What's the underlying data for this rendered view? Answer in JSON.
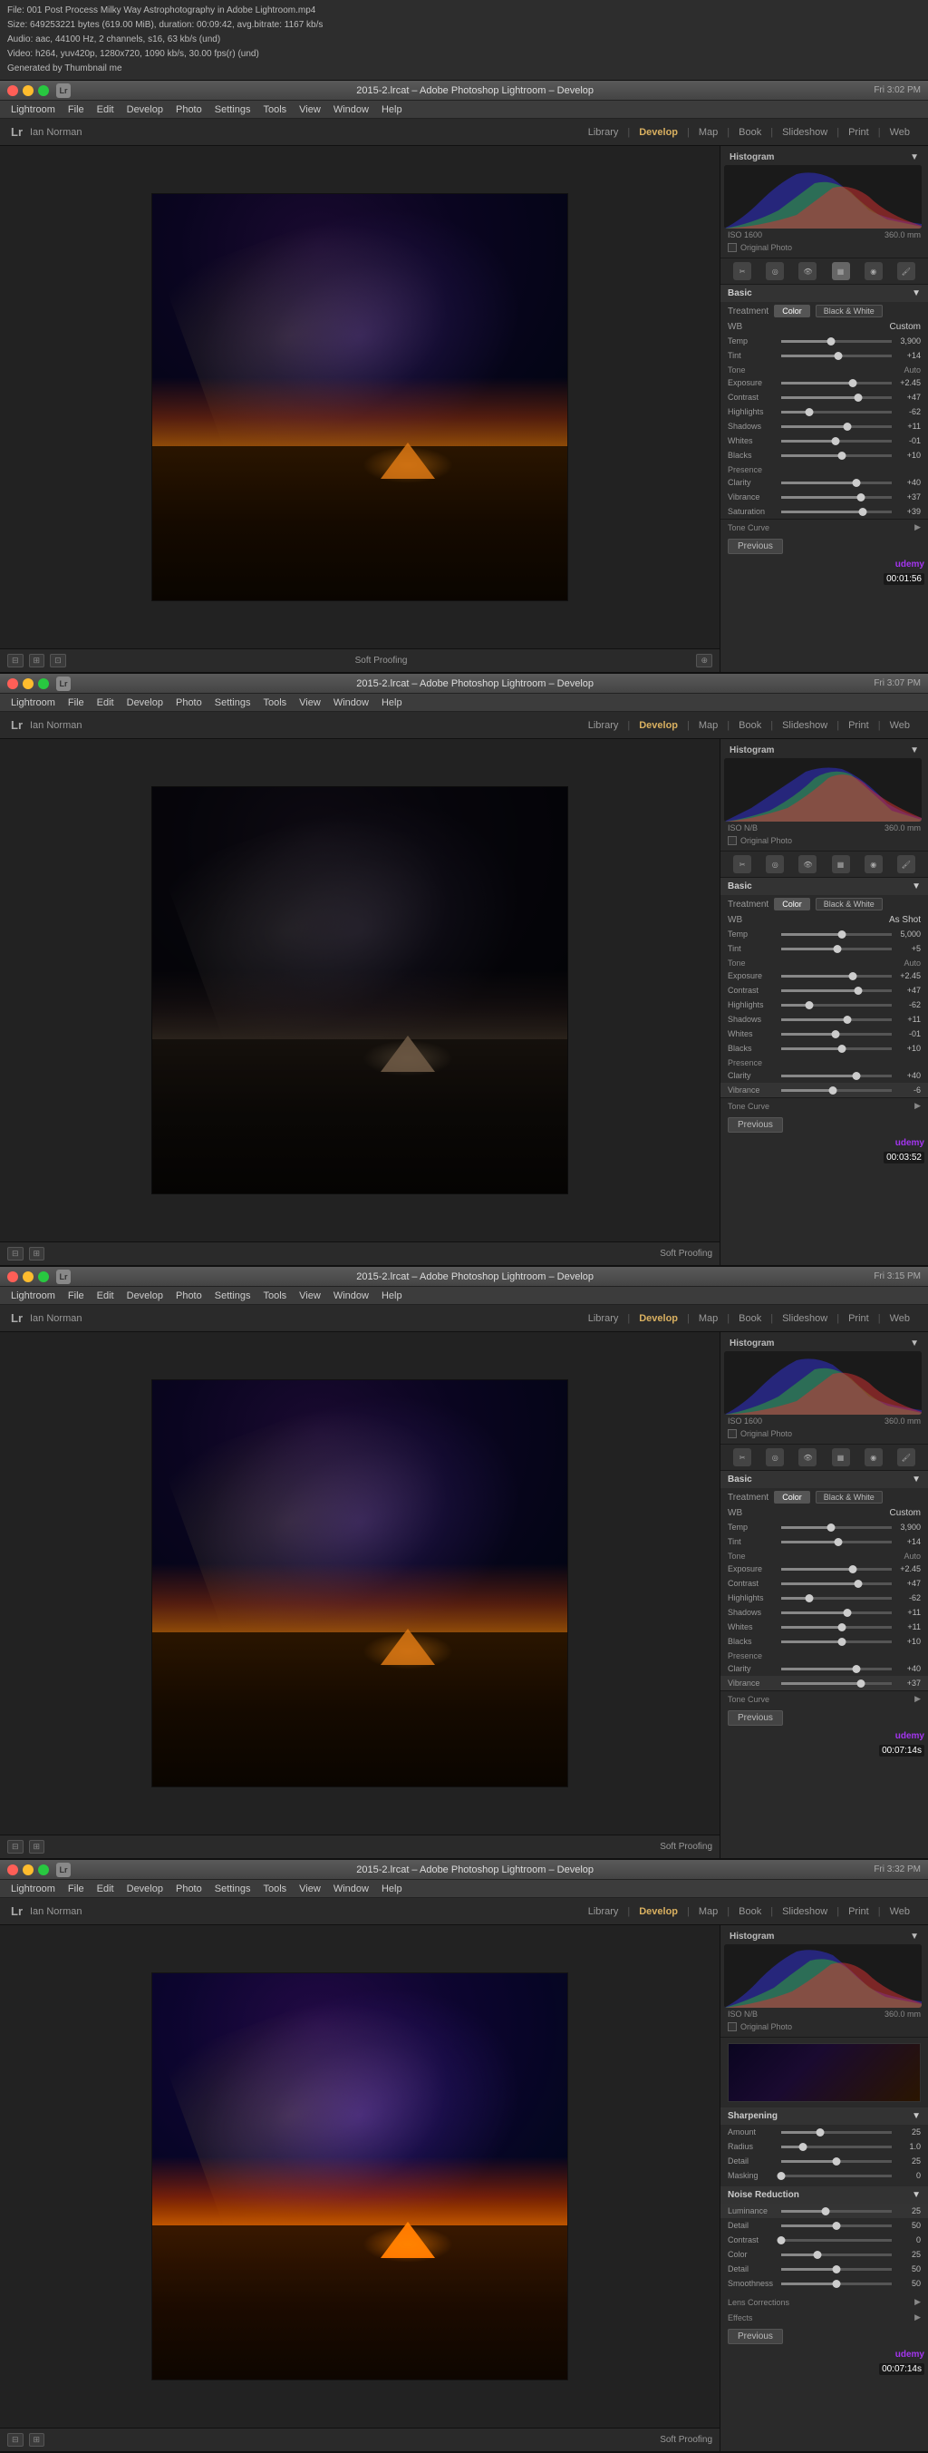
{
  "file_info": {
    "line1": "File: 001 Post Process Milky Way Astrophotography in Adobe Lightroom.mp4",
    "line2": "Size: 649253221 bytes (619.00 MiB), duration: 00:09:42, avg.bitrate: 1167 kb/s",
    "line3": "Audio: aac, 44100 Hz, 2 channels, s16, 63 kb/s (und)",
    "line4": "Video: h264, yuv420p, 1280x720, 1090 kb/s, 30.00 fps(r) (und)",
    "line5": "Generated by Thumbnail me"
  },
  "frames": [
    {
      "id": "frame1",
      "title_bar": "2015-2.lrcat – Adobe Photoshop Lightroom – Develop",
      "time_display": "Fri 3:02 PM",
      "user": "Ian Norman",
      "nav_active": "Develop",
      "nav_items": [
        "Library",
        "Develop",
        "Map",
        "Book",
        "Slideshow",
        "Print",
        "Web"
      ],
      "right_panel": {
        "iso": "ISO 1600",
        "exposure_info": "360.0 mm",
        "wb": "Custom",
        "wb_label": "WB",
        "temp": "3,900",
        "tint": "+14",
        "tone_label": "Tone",
        "tone_auto": "Auto",
        "exposure": "+2.45",
        "contrast": "+47",
        "highlights": "-62",
        "shadows": "+11",
        "whites": "-01",
        "blacks": "+10",
        "presence_label": "Presence",
        "clarity": "+40",
        "vibrance": "+37",
        "saturation": "+39"
      },
      "timestamp": "00:01:56",
      "soft_proofing": "Soft Proofing"
    },
    {
      "id": "frame2",
      "title_bar": "2015-2.lrcat – Adobe Photoshop Lightroom – Develop",
      "time_display": "Fri 3:07 PM",
      "user": "Ian Norman",
      "nav_active": "Develop",
      "nav_items": [
        "Library",
        "Develop",
        "Map",
        "Book",
        "Slideshow",
        "Print",
        "Web"
      ],
      "right_panel": {
        "iso": "ISO N/B",
        "exposure_info": "360.0 mm",
        "wb": "As Shot",
        "wb_label": "WB",
        "temp": "5,000",
        "tint": "+5",
        "tone_label": "Tone",
        "tone_auto": "Auto",
        "exposure": "+2.45",
        "contrast": "+47",
        "highlights": "-62",
        "shadows": "+11",
        "whites": "-01",
        "blacks": "+10",
        "presence_label": "Presence",
        "clarity": "+40",
        "vibrance": "-6",
        "saturation": ""
      },
      "timestamp": "00:03:52",
      "soft_proofing": "Soft Proofing"
    },
    {
      "id": "frame3",
      "title_bar": "2015-2.lrcat – Adobe Photoshop Lightroom – Develop",
      "time_display": "Fri 3:15 PM",
      "user": "Ian Norman",
      "nav_active": "Develop",
      "nav_items": [
        "Library",
        "Develop",
        "Map",
        "Book",
        "Slideshow",
        "Print",
        "Web"
      ],
      "right_panel": {
        "iso": "ISO 1600",
        "exposure_info": "360.0 mm",
        "wb": "Custom",
        "wb_label": "WB",
        "temp": "3,900",
        "tint": "+14",
        "tone_label": "Tone",
        "tone_auto": "Auto",
        "exposure": "+2.45",
        "contrast": "+47",
        "highlights": "-62",
        "shadows": "+11",
        "whites": "+11",
        "blacks": "+10",
        "presence_label": "Presence",
        "clarity": "+40",
        "vibrance": "+37",
        "saturation": ""
      },
      "timestamp": "00:07:14s",
      "soft_proofing": "Soft Proofing"
    },
    {
      "id": "frame4",
      "title_bar": "2015-2.lrcat – Adobe Photoshop Lightroom – Develop",
      "time_display": "Fri 3:32 PM",
      "user": "Ian Norman",
      "nav_active": "Develop",
      "nav_items": [
        "Library",
        "Develop",
        "Map",
        "Book",
        "Slideshow",
        "Print",
        "Web"
      ],
      "right_panel": {
        "iso": "ISO N/B",
        "exposure_info": "360.0 mm",
        "sharpening_label": "Sharpening",
        "amount": "Amount",
        "radius": "Radius",
        "detail": "Detail",
        "masking": "Masking",
        "noise_reduction": "Noise Reduction",
        "luminance": "Luminance",
        "detail2": "Detail",
        "contrast2": "Contrast",
        "color": "Color",
        "detail3": "Detail",
        "smoothness": "Smoothness",
        "lens_corrections": "Lens Corrections",
        "effects_label": "Effects"
      },
      "timestamp": "00:07:14s",
      "soft_proofing": "Soft Proofing"
    }
  ],
  "colors": {
    "accent": "#d9b060",
    "active_nav": "#d9b060",
    "bg_dark": "#2a2a2a",
    "bg_panel": "#333333",
    "udemy_purple": "#a435f0"
  },
  "labels": {
    "library": "Library",
    "develop": "Develop",
    "map": "Map",
    "book": "Book",
    "slideshow": "Slideshow",
    "print": "Print",
    "web": "Web",
    "histogram": "Histogram",
    "basic": "Basic",
    "treatment": "Treatment",
    "color": "Color",
    "black_white": "Black & White",
    "wb": "WB",
    "tone": "Tone",
    "auto": "Auto",
    "exposure": "Exposure",
    "contrast": "Contrast",
    "highlights": "Highlights",
    "shadows": "Shadows",
    "whites": "Whites",
    "blacks": "Blacks",
    "presence": "Presence",
    "clarity": "Clarity",
    "vibrance": "Vibrance",
    "saturation": "Saturation",
    "tone_curve": "Tone Curve",
    "previous": "Previous",
    "soft_proofing": "Soft Proofing",
    "original_photo": "Original Photo",
    "udemy": "udemy"
  }
}
